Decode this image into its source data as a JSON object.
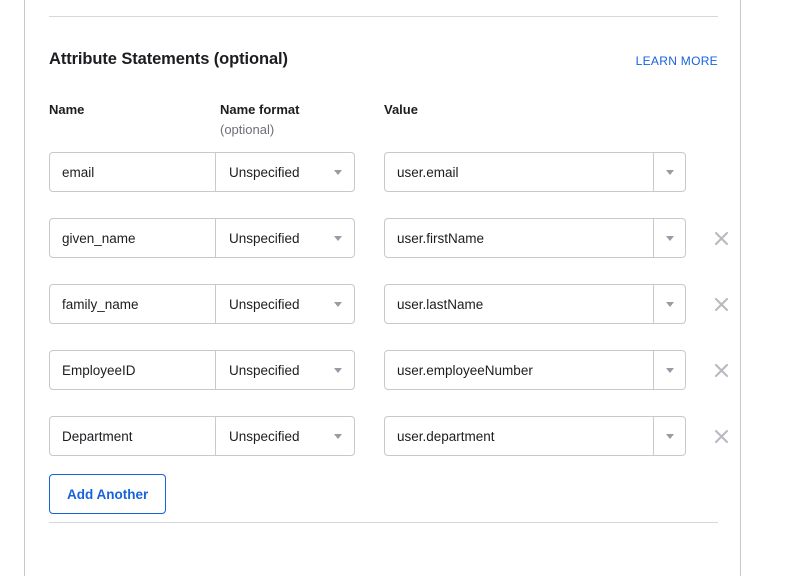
{
  "section": {
    "title": "Attribute Statements (optional)",
    "learn_more_label": "LEARN MORE"
  },
  "columns": {
    "name": "Name",
    "name_format": "Name format",
    "name_format_sub": "(optional)",
    "value": "Value"
  },
  "icons": {
    "caret": "chevron-down-icon",
    "remove": "close-icon"
  },
  "colors": {
    "accent": "#1662dd",
    "border": "#c8c8cd",
    "divider": "#d6d6dc",
    "text": "#1d1d21",
    "muted": "#6e6e78",
    "icon_muted": "#9a9aa4",
    "remove_icon": "#b9b9c2"
  },
  "rows": [
    {
      "name": "email",
      "name_placeholder": "",
      "format": "Unspecified",
      "value": "user.email",
      "value_placeholder": "",
      "removable": false
    },
    {
      "name": "given_name",
      "name_placeholder": "",
      "format": "Unspecified",
      "value": "user.firstName",
      "value_placeholder": "",
      "removable": true
    },
    {
      "name": "family_name",
      "name_placeholder": "",
      "format": "Unspecified",
      "value": "user.lastName",
      "value_placeholder": "",
      "removable": true
    },
    {
      "name": "EmployeeID",
      "name_placeholder": "",
      "format": "Unspecified",
      "value": "user.employeeNumber",
      "value_placeholder": "",
      "removable": true
    },
    {
      "name": "Department",
      "name_placeholder": "",
      "format": "Unspecified",
      "value": "user.department",
      "value_placeholder": "",
      "removable": true
    }
  ],
  "add_another": {
    "label": "Add Another"
  }
}
